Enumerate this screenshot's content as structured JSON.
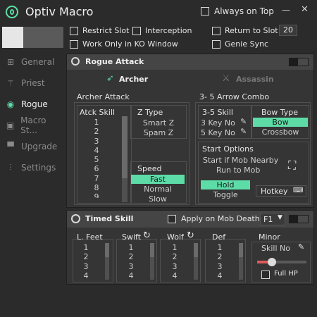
{
  "window": {
    "title": "Optiv Macro",
    "always_on_top": "Always on Top",
    "minimize": "—",
    "close": "✕"
  },
  "top_options": {
    "restrict_slot": "Restrict Slot",
    "interception": "Interception",
    "return_to_slot": "Return to Slot",
    "return_to_slot_value": "20",
    "work_only_ko": "Work Only in KO Window",
    "genie_sync": "Genie Sync"
  },
  "sidebar": {
    "items": [
      {
        "label": "General",
        "icon": "⊞"
      },
      {
        "label": "Priest",
        "icon": "⚚"
      },
      {
        "label": "Rogue",
        "icon": "◉"
      },
      {
        "label": "Macro St...",
        "icon": "▣"
      },
      {
        "label": "Upgrade",
        "icon": "▀"
      },
      {
        "label": "Settings",
        "icon": "⫶"
      }
    ]
  },
  "rogue_attack": {
    "title": "Rogue Attack",
    "tab_archer": "Archer",
    "tab_assassin": "Assassin",
    "archer_attack": {
      "title": "Archer Attack",
      "atck_skill_header": "Atck Skill",
      "skills": [
        "1",
        "2",
        "3",
        "4",
        "5",
        "6",
        "7",
        "8",
        "9"
      ],
      "z_type": {
        "title": "Z Type",
        "options": [
          "Smart Z",
          "Spam Z"
        ]
      },
      "speed": {
        "title": "Speed",
        "options": [
          "Fast",
          "Normal",
          "Slow"
        ],
        "selected": "Fast"
      }
    },
    "combo": {
      "title": "3- 5 Arrow Combo",
      "skill_header": "3-5 Skill",
      "key3": "3 Key No",
      "key5": "5 Key No",
      "bow_type_header": "Bow Type",
      "bow_options": [
        "Bow",
        "Crossbow"
      ],
      "bow_selected": "Bow",
      "start_options": {
        "title": "Start Options",
        "line1": "Start if Mob Nearby",
        "line2": "Run to Mob",
        "mode_options": [
          "Hold",
          "Toggle"
        ],
        "mode_selected": "Hold",
        "hotkey": "Hotkey"
      }
    }
  },
  "timed_skill": {
    "title": "Timed Skill",
    "apply_on_mob_death": "Apply on Mob Death",
    "key_select": "F1",
    "columns": [
      {
        "header": "L. Feet",
        "items": [
          "1",
          "2",
          "3",
          "4"
        ]
      },
      {
        "header": "Swift",
        "items": [
          "1",
          "2",
          "3",
          "4"
        ]
      },
      {
        "header": "Wolf",
        "items": [
          "1",
          "2",
          "3",
          "4"
        ]
      },
      {
        "header": "Def",
        "items": [
          "1",
          "2",
          "3",
          "4"
        ]
      }
    ],
    "minor": {
      "title": "Minor",
      "skill_no": "Skill No",
      "full_hp": "Full HP",
      "level": 0.3
    }
  },
  "colors": {
    "accent": "#5ddca8",
    "slider": "#e05a5a"
  }
}
